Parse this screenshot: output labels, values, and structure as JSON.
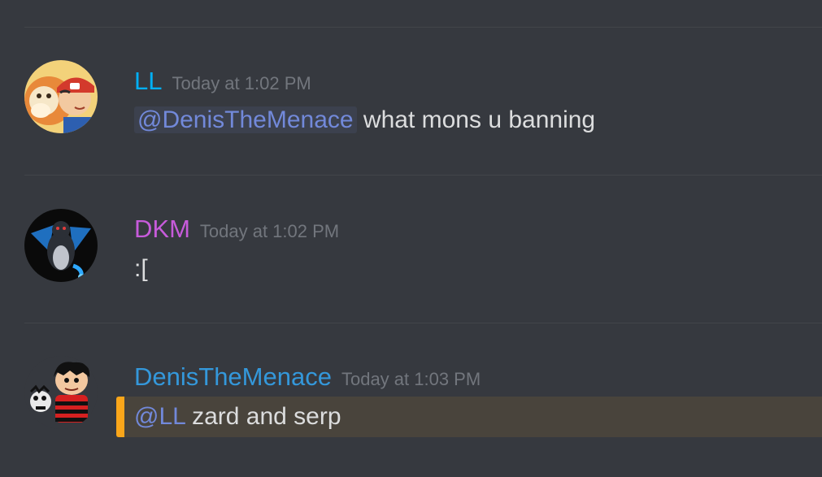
{
  "colors": {
    "background": "#36393f",
    "divider": "#42454a",
    "timestamp": "#72767d",
    "text": "#dcddde",
    "mention": "#7289da",
    "highlight_bg": "#49443c",
    "highlight_bar": "#faa61a"
  },
  "messages": [
    {
      "username": "LL",
      "username_color": "#00aff4",
      "timestamp": "Today at 1:02 PM",
      "avatar_icon": "anime-character-with-dog-avatar",
      "mention": "@DenisTheMenace",
      "text": "what mons u banning"
    },
    {
      "username": "DKM",
      "username_color": "#c75bdb",
      "timestamp": "Today at 1:02 PM",
      "avatar_icon": "black-charizard-avatar",
      "text": ":["
    },
    {
      "username": "DenisTheMenace",
      "username_color": "#3498db",
      "timestamp": "Today at 1:03 PM",
      "avatar_icon": "dennis-the-menace-cartoon-avatar",
      "mention": "@LL",
      "text": "zard and serp",
      "highlighted": true
    }
  ]
}
